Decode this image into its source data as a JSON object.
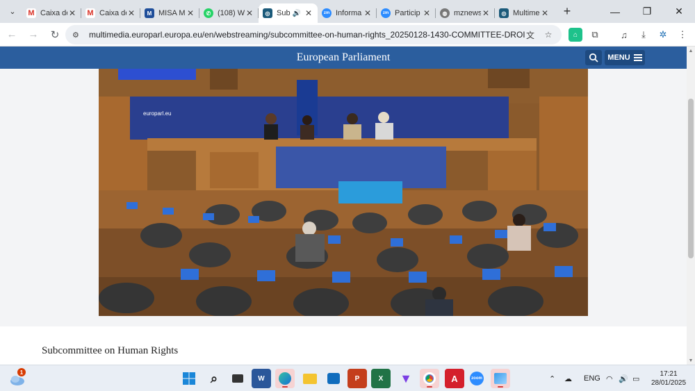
{
  "browser": {
    "tabs": [
      {
        "title": "Caixa de",
        "favicon": "gmail-icon",
        "active": false
      },
      {
        "title": "Caixa de",
        "favicon": "gmail-icon",
        "active": false
      },
      {
        "title": "MISA M",
        "favicon": "misa-icon",
        "active": false
      },
      {
        "title": "(108) W",
        "favicon": "whatsapp-icon",
        "active": false
      },
      {
        "title": "Sub",
        "favicon": "europarl-icon",
        "active": true,
        "audio": true
      },
      {
        "title": "Informa",
        "favicon": "zoom-icon",
        "active": false
      },
      {
        "title": "Particip",
        "favicon": "zoom-icon",
        "active": false
      },
      {
        "title": "mznews",
        "favicon": "globe-icon",
        "active": false
      },
      {
        "title": "Multime",
        "favicon": "europarl-icon",
        "active": false
      }
    ],
    "url": "multimedia.europarl.europa.eu/en/webstreaming/subcommittee-on-human-rights_20250128-1430-COMMITTEE-DROI"
  },
  "page": {
    "site_title": "European Parliament",
    "menu_label": "MENU",
    "committee_title": "Subcommittee on Human Rights",
    "video_labels": {
      "brand": "europarl.eu"
    }
  },
  "taskbar": {
    "weather_badge": "1",
    "language": "ENG",
    "time": "17:21",
    "date": "28/01/2025"
  },
  "colors": {
    "ep_blue": "#2b5e9e",
    "taskbar_bg": "#e9eef5"
  }
}
